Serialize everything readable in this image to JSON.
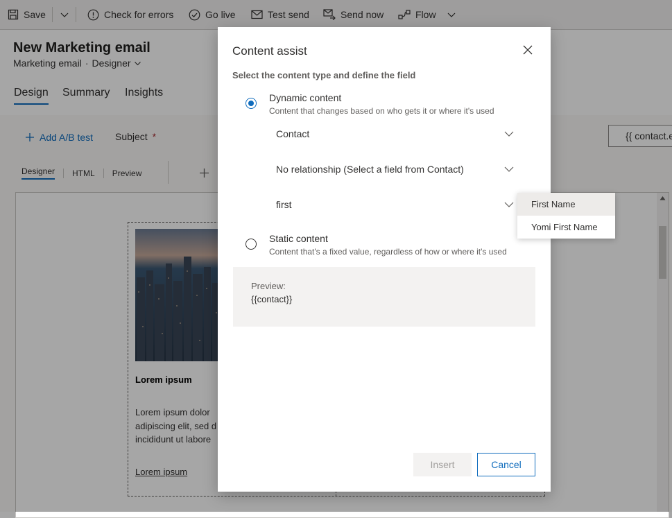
{
  "toolbar": {
    "save": "Save",
    "check_errors": "Check for errors",
    "go_live": "Go live",
    "test_send": "Test send",
    "send_now": "Send now",
    "flow": "Flow"
  },
  "record": {
    "title": "New Marketing email",
    "entity": "Marketing email",
    "separator": "·",
    "form": "Designer"
  },
  "tabs": [
    "Design",
    "Summary",
    "Insights"
  ],
  "designer": {
    "add_ab_test": "Add A/B test",
    "subject_label": "Subject",
    "required_mark": "*",
    "subject_value": "{{ contact.e",
    "view_tabs": [
      "Designer",
      "HTML",
      "Preview"
    ]
  },
  "email_content": {
    "heading": "Lorem ipsum",
    "body": "Lorem ipsum dolor adipiscing elit, sed d incididunt ut labore",
    "link": "Lorem ipsum"
  },
  "dialog": {
    "title": "Content assist",
    "instruction": "Select the content type and define the field",
    "dynamic": {
      "title": "Dynamic content",
      "description": "Content that changes based on who gets it or where it's used",
      "selected": true
    },
    "dropdowns": [
      {
        "value": "Contact"
      },
      {
        "value": "No relationship (Select a field from Contact)"
      },
      {
        "value": "first"
      }
    ],
    "static": {
      "title": "Static content",
      "description": "Content that's a fixed value, regardless of how or where it's used",
      "selected": false
    },
    "preview_label": "Preview:",
    "preview_value": "{{contact}}",
    "insert": "Insert",
    "cancel": "Cancel"
  },
  "suggestions": [
    "First Name",
    "Yomi First Name"
  ],
  "colors": {
    "accent": "#0f6cbd",
    "dialog_bg": "#ffffff",
    "overlay": "#a6a6a6"
  }
}
